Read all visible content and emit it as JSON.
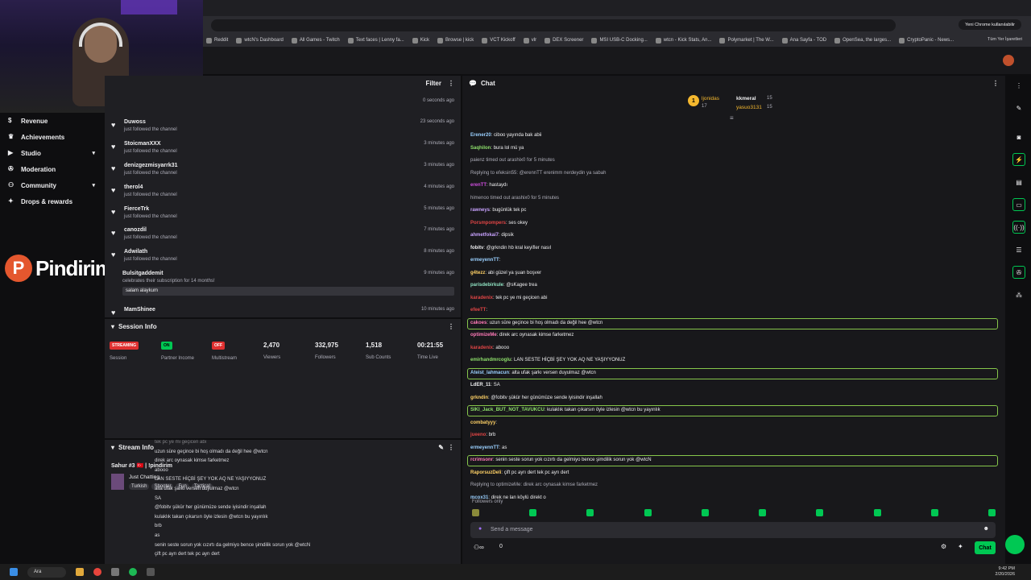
{
  "browser": {
    "profile_label": "Yeni Chrome kullanılabilir",
    "bookmarks": [
      "Reddit",
      "wtcN's Dashboard",
      "All Games - Twitch",
      "Text faces | Lenny fa...",
      "Kick",
      "Browse | kick",
      "VCT Kickoff",
      "vlr",
      "DEX Screener",
      "MSI USB-C Docking...",
      "wtcn - Kick Stats, An...",
      "Polymarket | The W...",
      "Ana Sayfa - TOD",
      "OpenSea, the larges...",
      "CryptoPanic - News..."
    ],
    "all_bookmarks_label": "Tüm Yer İşaretleri"
  },
  "sidebar": {
    "items": [
      {
        "label": "Revenue",
        "icon": "dollar-icon",
        "expand": false
      },
      {
        "label": "Achievements",
        "icon": "trophy-icon",
        "expand": false
      },
      {
        "label": "Studio",
        "icon": "video-icon",
        "expand": true
      },
      {
        "label": "Moderation",
        "icon": "wrench-icon",
        "expand": false
      },
      {
        "label": "Community",
        "icon": "people-icon",
        "expand": true
      },
      {
        "label": "Drops & rewards",
        "icon": "gift-icon",
        "expand": false
      }
    ]
  },
  "watermark": {
    "text": "Pindirim"
  },
  "activity": {
    "filter_label": "Filter",
    "top_time": "0 seconds ago",
    "rows": [
      {
        "name": "Duwoss",
        "desc": "just followed the channel",
        "time": "23 seconds ago"
      },
      {
        "name": "StoicmanXXX",
        "desc": "just followed the channel",
        "time": "3 minutes ago"
      },
      {
        "name": "denizgezmisyarrk31",
        "desc": "just followed the channel",
        "time": "3 minutes ago"
      },
      {
        "name": "therol4",
        "desc": "just followed the channel",
        "time": "4 minutes ago"
      },
      {
        "name": "FierceTrk",
        "desc": "just followed the channel",
        "time": "5 minutes ago"
      },
      {
        "name": "canozdil",
        "desc": "just followed the channel",
        "time": "7 minutes ago"
      },
      {
        "name": "Adwilath",
        "desc": "just followed the channel",
        "time": "8 minutes ago"
      },
      {
        "name": "Bulsitgaddemit",
        "desc": "celebrates their subscription for 14 months!",
        "time": "9 minutes ago"
      },
      {
        "name": "MamShinee",
        "desc": "",
        "time": "10 minutes ago"
      }
    ],
    "sub_message": "salam alaykum"
  },
  "session": {
    "title": "Session Info",
    "streaming_badge": "STREAMING",
    "session_label": "Session",
    "on_badge": "ON",
    "partner_label": "Partner Income",
    "off_badge": "OFF",
    "multistream_label": "Multistream",
    "stats": [
      {
        "value": "2,470",
        "label": "Viewers"
      },
      {
        "value": "332,975",
        "label": "Followers"
      },
      {
        "value": "1,518",
        "label": "Sub Counts"
      },
      {
        "value": "00:21:55",
        "label": "Time Live"
      }
    ]
  },
  "stream_info": {
    "title": "Stream Info",
    "stream_title": "Sahur #3 🇹🇷 | !pindirim",
    "category": "Just Chatting",
    "tags": [
      "Turkish",
      "Shooter",
      "Fun",
      "Tactical"
    ],
    "overlay_lines": [
      "tek pc ye mi geçicen abi",
      "uzun süre geçince bi hoş olmadı da değil hee @wtcn",
      "direk arc oynasak kimse farketmez",
      "abooo",
      "LAN SESTE HİÇBİ ŞEY YOK AQ NE YAŞIYYONUZ",
      "alta ufak şarkı versen duyulmaz @wtcn",
      "SA",
      "@fobitv şükür her günümüze sende iyisindir inşallah",
      "kulaklık takan çıkarsın öyle izlesin @wtcn bu yayınlık",
      "brb",
      "as",
      "senin seste sorun yok cızırtı da gelmiyo bence şimdilik sorun yok @wtcN",
      "çift pc ayrı dert tek pc ayrı dert"
    ]
  },
  "chat": {
    "title": "Chat",
    "leaderboard": [
      {
        "rank": "1",
        "name": "ljonidas",
        "count": "17"
      },
      {
        "name": "kkmeral",
        "count": "15"
      },
      {
        "name": "yasuo3131",
        "count": "15"
      }
    ],
    "messages": [
      {
        "user": "Erener20",
        "text": "ciboo yayında bak abii",
        "color": "#9ad0ff",
        "hl": false
      },
      {
        "user": "Saqhilon",
        "text": "bura lol mü ya",
        "color": "#8ee06b",
        "hl": false
      },
      {
        "user": "",
        "text": "paienz timed out arashix0 for 5 minutes",
        "color": "#adadb8",
        "hl": false,
        "sys": true
      },
      {
        "user": "",
        "text": "Replying to efeksin55: @erennTT erenimm nerdeydin ya sabah",
        "color": "#adadb8",
        "hl": false,
        "sys": true
      },
      {
        "user": "erenTT",
        "text": "hastaydı",
        "color": "#d04fe0",
        "hl": false
      },
      {
        "user": "",
        "text": "himenoo timed out arashix0 for 5 minutes",
        "color": "#adadb8",
        "hl": false,
        "sys": true
      },
      {
        "user": "rawneys",
        "text": "bugünlük tek pc",
        "color": "#c8a2ff",
        "hl": false
      },
      {
        "user": "Porsmpompers",
        "text": "ses okey",
        "color": "#e04545",
        "hl": false
      },
      {
        "user": "ahmetfokai7",
        "text": "dipsik",
        "color": "#c8a2ff",
        "hl": false
      },
      {
        "user": "fobitv",
        "text": "@grkndin hb kral keyifler nasıl",
        "color": "#efeff1",
        "hl": false
      },
      {
        "user": "ermeyennTT",
        "text": "",
        "color": "#9ad0ff",
        "hl": false
      },
      {
        "user": "g4tezz",
        "text": "abi güzel ya şuan boşver",
        "color": "#ffd166",
        "hl": false
      },
      {
        "user": "parisdebirkule",
        "text": "@sKagee trea",
        "color": "#8ee0c0",
        "hl": false
      },
      {
        "user": "karadenix",
        "text": "tek pc ye mi geçicen abi",
        "color": "#e04545",
        "hl": false
      },
      {
        "user": "efeeTT",
        "text": "",
        "color": "#e04545",
        "hl": false
      },
      {
        "user": "cakoes",
        "text": "uzun süre geçince bi hoş olmadı da değil hee @wtcn",
        "color": "#ff7ab8",
        "hl": true
      },
      {
        "user": "optimizeMe",
        "text": "direk arc oynasak kimse farketmez",
        "color": "#ff7ab8",
        "hl": false
      },
      {
        "user": "karadenix",
        "text": "abooo",
        "color": "#e04545",
        "hl": false
      },
      {
        "user": "emirhandmrcoglu",
        "text": "LAN SESTE HİÇBİ ŞEY YOK AQ NE YAŞIYYONUZ",
        "color": "#8ee06b",
        "hl": false
      },
      {
        "user": "Ateist_lahmacun",
        "text": "alta ufak şarkı versen duyulmaz @wtcn",
        "color": "#9ad0ff",
        "hl": true
      },
      {
        "user": "LdER_11",
        "text": "SA",
        "color": "#efeff1",
        "hl": false
      },
      {
        "user": "grkndin",
        "text": "@fobitv şükür her günümüze sende iyisindir inşallah",
        "color": "#ffd166",
        "hl": false
      },
      {
        "user": "SIKI_Jack_BUT_NOT_TAVUKCU",
        "text": "kulaklık takan çıkarsın öyle izlesin @wtcn bu yayınlık",
        "color": "#8ee06b",
        "hl": true
      },
      {
        "user": "combatyyy",
        "text": "",
        "color": "#ffd166",
        "hl": false
      },
      {
        "user": "jueeno",
        "text": "brb",
        "color": "#e04545",
        "hl": false
      },
      {
        "user": "ermeyennTT",
        "text": "as",
        "color": "#9ad0ff",
        "hl": false
      },
      {
        "user": "rcrimsonr",
        "text": "senin seste sorun yok cızırtı da gelmiyo bence şimdilik sorun yok @wtcN",
        "color": "#ff7ab8",
        "hl": true
      },
      {
        "user": "RaporsuzDeli",
        "text": "çift pc ayrı dert tek pc ayrı dert",
        "color": "#ffd166",
        "hl": false
      },
      {
        "user": "",
        "text": "Replying to optimizeMe: direk arc oynasak kimse farketmez",
        "color": "#adadb8",
        "hl": false,
        "sys": true
      },
      {
        "user": "mcox31",
        "text": "direk ne lan köylü direkt o",
        "color": "#9ad0ff",
        "hl": false
      }
    ],
    "followers_only": "Followers only",
    "input_placeholder": "Send a message",
    "chat_button": "Chat",
    "viewer_count": "0"
  },
  "taskbar": {
    "search_label": "Ara",
    "time": "9:42 PM",
    "date": "2/20/2026"
  },
  "colors": {
    "accent_green": "#00c853",
    "panel": "#1f1f23",
    "highlight_border": "#86c64b"
  }
}
